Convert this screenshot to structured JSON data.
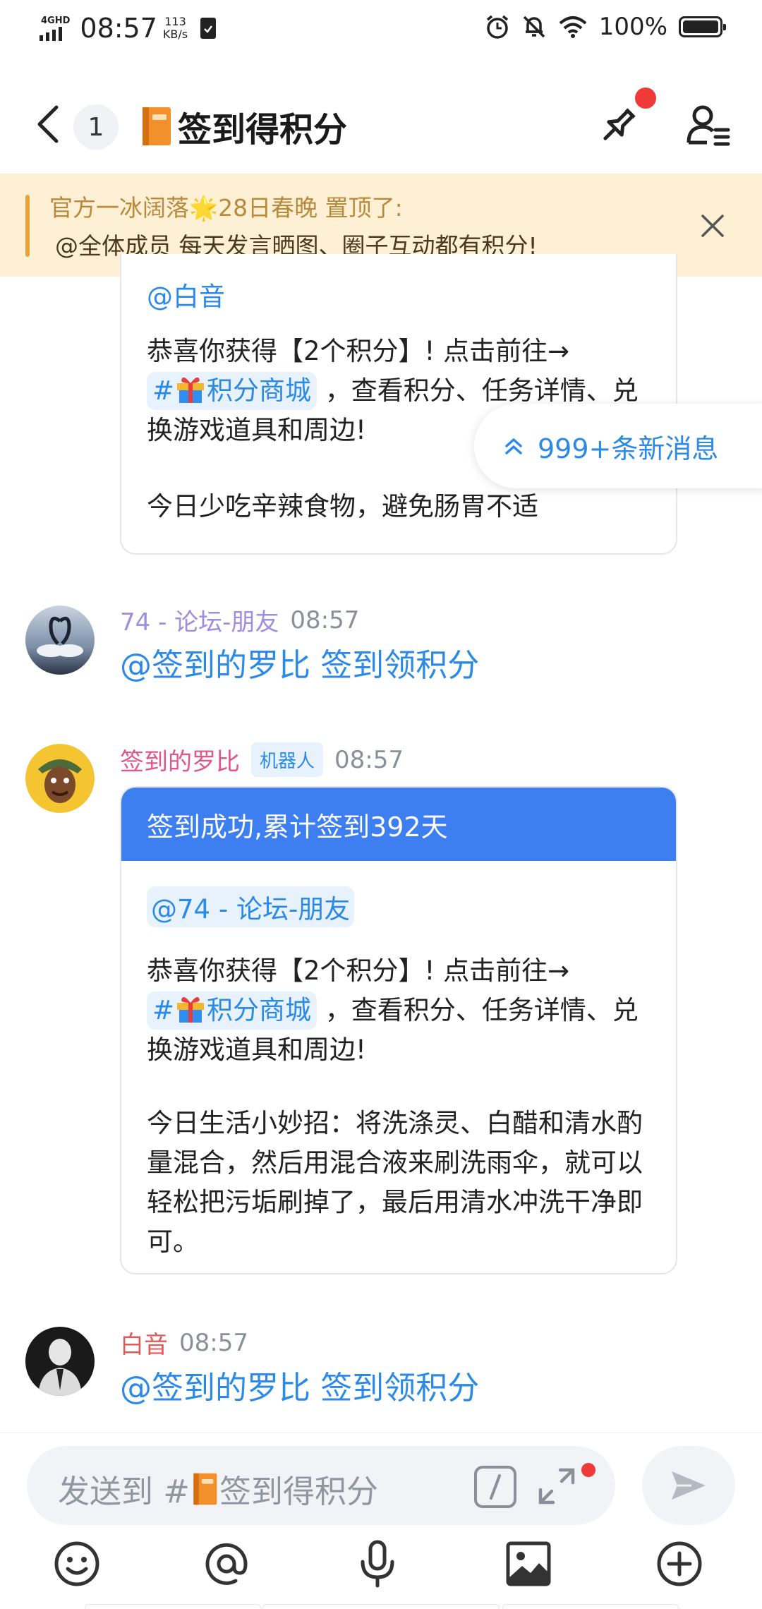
{
  "status_bar": {
    "network": "4GHD",
    "time": "08:57",
    "speed_value": "113",
    "speed_unit": "KB/s",
    "battery": "100%"
  },
  "header": {
    "unread_count": "1",
    "title": "签到得积分"
  },
  "notice": {
    "line1": "官方一冰阔落🌟28日春晚 置顶了:",
    "line2": "@全体成员 每天发言晒图、圈子互动都有积分!"
  },
  "card_top": {
    "mention": "@白音",
    "p1_before": "恭喜你获得【2个积分】! 点击前往→",
    "tag": "#",
    "tag_label": "积分商城",
    "p1_after": " ，查看积分、任务详情、兑换游戏道具和周边!",
    "tip": "今日少吃辛辣食物，避免肠胃不适"
  },
  "new_messages": {
    "label": "999+条新消息"
  },
  "messages": [
    {
      "name": "74 - 论坛-朋友",
      "time": "08:57",
      "text": "@签到的罗比 签到领积分",
      "name_color": "#9b8fe0"
    },
    {
      "name": "签到的罗比",
      "bot_label": "机器人",
      "time": "08:57",
      "name_color": "#e0558c"
    },
    {
      "name": "白音",
      "time": "08:57",
      "text": "@签到的罗比 签到领积分",
      "name_color": "#e05a5a"
    }
  ],
  "card_bot": {
    "header": "签到成功,累计签到392天",
    "mention": "@74 - 论坛-朋友",
    "p1_before": "恭喜你获得【2个积分】! 点击前往→",
    "tag": "#",
    "tag_label": "积分商城",
    "p1_after": " ，查看积分、任务详情、兑换游戏道具和周边!",
    "tip": "今日生活小妙招：将洗涤灵、白醋和清水酌量混合，然后用混合液来刷洗雨伞，就可以轻松把污垢刷掉了，最后用清水冲洗干净即可。"
  },
  "input": {
    "placeholder_prefix": "发送到 #",
    "placeholder_channel": "签到得积分"
  },
  "colors": {
    "accent": "#2b8ae6",
    "card_header": "#3d7ef0",
    "notice_bg": "#fdf0d4",
    "badge_red": "#ef3a3a"
  },
  "icons": [
    "back-icon",
    "book-icon",
    "pin-icon",
    "members-icon",
    "close-icon",
    "chevron-double-up-icon",
    "gift-icon",
    "slash-icon",
    "expand-icon",
    "send-icon",
    "emoji-icon",
    "at-icon",
    "mic-icon",
    "image-icon",
    "plus-circle-icon"
  ]
}
